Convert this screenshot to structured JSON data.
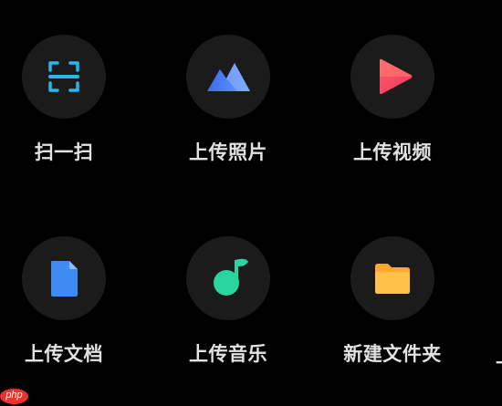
{
  "items": [
    {
      "name": "scan",
      "label": "扫一扫",
      "icon": "scan-icon"
    },
    {
      "name": "upload-photo",
      "label": "上传照片",
      "icon": "photo-mountain-icon"
    },
    {
      "name": "upload-video",
      "label": "上传视频",
      "icon": "play-video-icon"
    },
    {
      "name": "upload-document",
      "label": "上传文档",
      "icon": "document-icon"
    },
    {
      "name": "upload-music",
      "label": "上传音乐",
      "icon": "music-note-icon"
    },
    {
      "name": "new-folder",
      "label": "新建文件夹",
      "icon": "folder-icon"
    }
  ],
  "partial_items": [
    {
      "label": "上"
    }
  ],
  "colors": {
    "background": "#000000",
    "circle": "#1b1b1c",
    "label": "#e2e2e2",
    "scan_accent": "#2bb5e8",
    "photo_accent": "#4f7cf5",
    "video_accent": "#f44a5c",
    "document_accent": "#3e8cf3",
    "music_accent": "#29d6a0",
    "folder_accent": "#ffb637"
  },
  "watermark": {
    "text": "php"
  }
}
